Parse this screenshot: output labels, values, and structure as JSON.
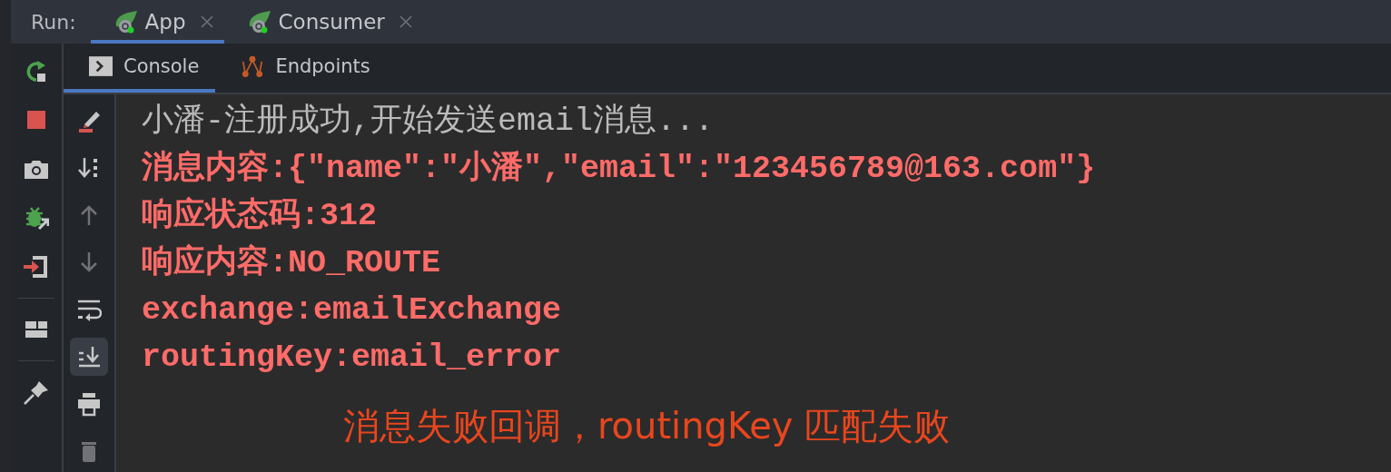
{
  "run_label": "Run:",
  "run_tabs": [
    {
      "label": "App",
      "selected": true,
      "running": true
    },
    {
      "label": "Consumer",
      "selected": false,
      "running": true
    }
  ],
  "console_tabs": [
    {
      "label": "Console",
      "kind": "console",
      "selected": true
    },
    {
      "label": "Endpoints",
      "kind": "endpoints",
      "selected": false
    }
  ],
  "side_tools": [
    {
      "kind": "rerun"
    },
    {
      "kind": "stop"
    },
    {
      "kind": "camera"
    },
    {
      "kind": "debug"
    },
    {
      "kind": "exit"
    },
    {
      "kind": "sep"
    },
    {
      "kind": "layout"
    },
    {
      "kind": "sep"
    },
    {
      "kind": "pin"
    }
  ],
  "console_tools": [
    {
      "kind": "clear",
      "on": false
    },
    {
      "kind": "sort",
      "on": false
    },
    {
      "kind": "up",
      "on": false
    },
    {
      "kind": "down",
      "on": false
    },
    {
      "kind": "wrap",
      "on": false
    },
    {
      "kind": "scroll-end",
      "on": true
    },
    {
      "kind": "print",
      "on": false
    },
    {
      "kind": "trash",
      "on": false
    }
  ],
  "lines": [
    {
      "text": "小潘-注册成功,开始发送email消息...",
      "kind": "stdout"
    },
    {
      "text": "消息内容:{\"name\":\"小潘\",\"email\":\"123456789@163.com\"}",
      "kind": "stderr"
    },
    {
      "text": "响应状态码:312",
      "kind": "stderr"
    },
    {
      "text": "响应内容:NO_ROUTE",
      "kind": "stderr"
    },
    {
      "text": "exchange:emailExchange",
      "kind": "stderr"
    },
    {
      "text": "routingKey:email_error",
      "kind": "stderr"
    }
  ],
  "annotation": "消息失败回调，routingKey 匹配失败"
}
